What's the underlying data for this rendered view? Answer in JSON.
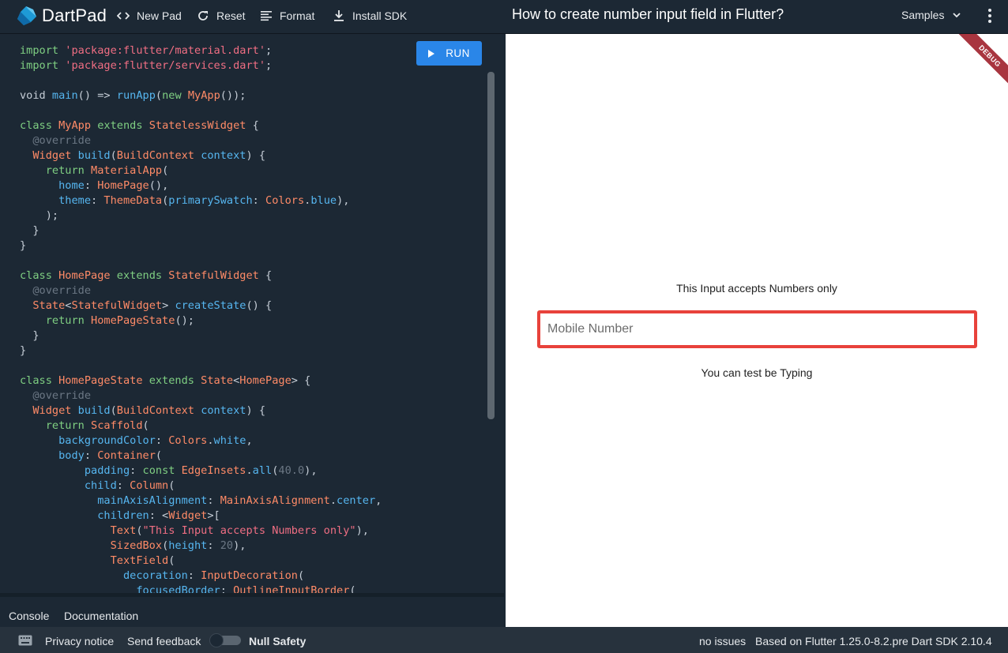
{
  "header": {
    "app_name": "DartPad",
    "new_pad": "New Pad",
    "reset": "Reset",
    "format": "Format",
    "install_sdk": "Install SDK",
    "page_title": "How to create number input field in Flutter?",
    "samples": "Samples"
  },
  "editor": {
    "run_label": "RUN"
  },
  "console_tabs": {
    "console": "Console",
    "documentation": "Documentation"
  },
  "preview": {
    "debug_label": "DEBUG",
    "heading_text": "This Input accepts Numbers only",
    "input_placeholder": "Mobile Number",
    "helper_text": "You can test be Typing"
  },
  "footer": {
    "privacy": "Privacy notice",
    "feedback": "Send feedback",
    "null_safety": "Null Safety",
    "issues": "no issues",
    "sdk_info": "Based on Flutter 1.25.0-8.2.pre Dart SDK 2.10.4"
  },
  "code_lines": [
    [
      [
        "k",
        "import "
      ],
      [
        "st",
        "'package:flutter/material.dart'"
      ],
      [
        "p",
        ";"
      ]
    ],
    [
      [
        "k",
        "import "
      ],
      [
        "st",
        "'package:flutter/services.dart'"
      ],
      [
        "p",
        ";"
      ]
    ],
    [],
    [
      [
        "p",
        "void "
      ],
      [
        "fn",
        "main"
      ],
      [
        "p",
        "() => "
      ],
      [
        "fn",
        "runApp"
      ],
      [
        "p",
        "("
      ],
      [
        "k",
        "new "
      ],
      [
        "ty",
        "MyApp"
      ],
      [
        "p",
        "());"
      ]
    ],
    [],
    [
      [
        "k",
        "class "
      ],
      [
        "ty",
        "MyApp "
      ],
      [
        "k",
        "extends "
      ],
      [
        "ty",
        "StatelessWidget "
      ],
      [
        "p",
        "{"
      ]
    ],
    [
      [
        "an",
        "  @override"
      ]
    ],
    [
      [
        "ty",
        "  Widget "
      ],
      [
        "fn",
        "build"
      ],
      [
        "p",
        "("
      ],
      [
        "ty",
        "BuildContext "
      ],
      [
        "pa",
        "context"
      ],
      [
        "p",
        ") {"
      ]
    ],
    [
      [
        "k",
        "    return "
      ],
      [
        "ty",
        "MaterialApp"
      ],
      [
        "p",
        "("
      ]
    ],
    [
      [
        "pa",
        "      home"
      ],
      [
        "p",
        ": "
      ],
      [
        "ty",
        "HomePage"
      ],
      [
        "p",
        "(),"
      ]
    ],
    [
      [
        "pa",
        "      theme"
      ],
      [
        "p",
        ": "
      ],
      [
        "ty",
        "ThemeData"
      ],
      [
        "p",
        "("
      ],
      [
        "pa",
        "primarySwatch"
      ],
      [
        "p",
        ": "
      ],
      [
        "ty",
        "Colors"
      ],
      [
        "p",
        "."
      ],
      [
        "fn",
        "blue"
      ],
      [
        "p",
        "),"
      ]
    ],
    [
      [
        "p",
        "    );"
      ]
    ],
    [
      [
        "p",
        "  }"
      ]
    ],
    [
      [
        "p",
        "}"
      ]
    ],
    [],
    [
      [
        "k",
        "class "
      ],
      [
        "ty",
        "HomePage "
      ],
      [
        "k",
        "extends "
      ],
      [
        "ty",
        "StatefulWidget "
      ],
      [
        "p",
        "{"
      ]
    ],
    [
      [
        "an",
        "  @override"
      ]
    ],
    [
      [
        "ty",
        "  State"
      ],
      [
        "p",
        "<"
      ],
      [
        "ty",
        "StatefulWidget"
      ],
      [
        "p",
        "> "
      ],
      [
        "fn",
        "createState"
      ],
      [
        "p",
        "() {"
      ]
    ],
    [
      [
        "k",
        "    return "
      ],
      [
        "ty",
        "HomePageState"
      ],
      [
        "p",
        "();"
      ]
    ],
    [
      [
        "p",
        "  }"
      ]
    ],
    [
      [
        "p",
        "}"
      ]
    ],
    [],
    [
      [
        "k",
        "class "
      ],
      [
        "ty",
        "HomePageState "
      ],
      [
        "k",
        "extends "
      ],
      [
        "ty",
        "State"
      ],
      [
        "p",
        "<"
      ],
      [
        "ty",
        "HomePage"
      ],
      [
        "p",
        "> {"
      ]
    ],
    [
      [
        "an",
        "  @override"
      ]
    ],
    [
      [
        "ty",
        "  Widget "
      ],
      [
        "fn",
        "build"
      ],
      [
        "p",
        "("
      ],
      [
        "ty",
        "BuildContext "
      ],
      [
        "pa",
        "context"
      ],
      [
        "p",
        ") {"
      ]
    ],
    [
      [
        "k",
        "    return "
      ],
      [
        "ty",
        "Scaffold"
      ],
      [
        "p",
        "("
      ]
    ],
    [
      [
        "pa",
        "      backgroundColor"
      ],
      [
        "p",
        ": "
      ],
      [
        "ty",
        "Colors"
      ],
      [
        "p",
        "."
      ],
      [
        "fn",
        "white"
      ],
      [
        "p",
        ","
      ]
    ],
    [
      [
        "pa",
        "      body"
      ],
      [
        "p",
        ": "
      ],
      [
        "ty",
        "Container"
      ],
      [
        "p",
        "("
      ]
    ],
    [
      [
        "pa",
        "          padding"
      ],
      [
        "p",
        ": "
      ],
      [
        "k",
        "const "
      ],
      [
        "ty",
        "EdgeInsets"
      ],
      [
        "p",
        "."
      ],
      [
        "fn",
        "all"
      ],
      [
        "p",
        "("
      ],
      [
        "nu",
        "40.0"
      ],
      [
        "p",
        "),"
      ]
    ],
    [
      [
        "pa",
        "          child"
      ],
      [
        "p",
        ": "
      ],
      [
        "ty",
        "Column"
      ],
      [
        "p",
        "("
      ]
    ],
    [
      [
        "pa",
        "            mainAxisAlignment"
      ],
      [
        "p",
        ": "
      ],
      [
        "ty",
        "MainAxisAlignment"
      ],
      [
        "p",
        "."
      ],
      [
        "fn",
        "center"
      ],
      [
        "p",
        ","
      ]
    ],
    [
      [
        "pa",
        "            children"
      ],
      [
        "p",
        ": <"
      ],
      [
        "ty",
        "Widget"
      ],
      [
        "p",
        ">["
      ]
    ],
    [
      [
        "ty",
        "              Text"
      ],
      [
        "p",
        "("
      ],
      [
        "st",
        "\"This Input accepts Numbers only\""
      ],
      [
        "p",
        "),"
      ]
    ],
    [
      [
        "ty",
        "              SizedBox"
      ],
      [
        "p",
        "("
      ],
      [
        "pa",
        "height"
      ],
      [
        "p",
        ": "
      ],
      [
        "nu",
        "20"
      ],
      [
        "p",
        "),"
      ]
    ],
    [
      [
        "ty",
        "              TextField"
      ],
      [
        "p",
        "("
      ]
    ],
    [
      [
        "pa",
        "                decoration"
      ],
      [
        "p",
        ": "
      ],
      [
        "ty",
        "InputDecoration"
      ],
      [
        "p",
        "("
      ]
    ],
    [
      [
        "pa",
        "                  focusedBorder"
      ],
      [
        "p",
        ": "
      ],
      [
        "ty",
        "OutlineInputBorder"
      ],
      [
        "p",
        "("
      ]
    ]
  ],
  "colors": {
    "accent": "#2a86e8",
    "focus_border": "#e8423b",
    "background": "#1c2834"
  }
}
